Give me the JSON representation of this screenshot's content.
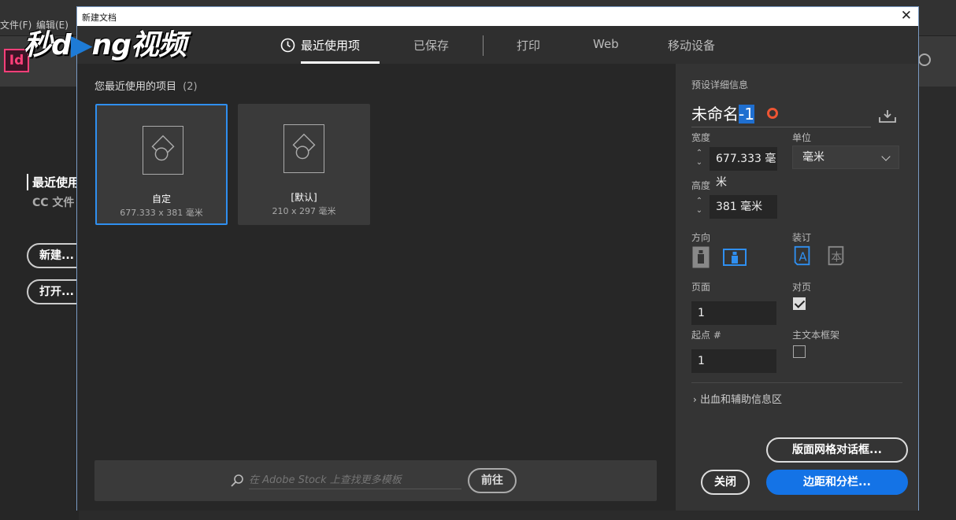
{
  "app": {
    "menu": [
      "文件(F)",
      "编辑(E)"
    ],
    "logo": "Id",
    "watermark": "秒懂视频",
    "left_panel": {
      "recent": "最近使用",
      "cc_files": "CC 文件",
      "new_button": "新建...",
      "open_button": "打开..."
    }
  },
  "dialog": {
    "title": "新建文档",
    "close_glyph": "✕",
    "tabs": [
      {
        "label": "最近使用项",
        "active": true
      },
      {
        "label": "已保存",
        "active": false
      },
      {
        "label": "打印",
        "active": false
      },
      {
        "label": "Web",
        "active": false
      },
      {
        "label": "移动设备",
        "active": false
      }
    ],
    "recent_label": "您最近使用的项目",
    "recent_count": "(2)",
    "presets": [
      {
        "name": "自定",
        "size": "677.333 x 381 毫米",
        "selected": true
      },
      {
        "name": "[默认]",
        "size": "210 x 297 毫米",
        "selected": false
      }
    ],
    "search": {
      "placeholder": "在 Adobe Stock 上查找更多模板",
      "go_label": "前往"
    }
  },
  "panel": {
    "heading": "预设详细信息",
    "doc_name": "未命名",
    "doc_name_selected": "-1",
    "width_label": "宽度",
    "width_value": "677.333 毫米",
    "unit_label": "单位",
    "unit_value": "毫米",
    "height_label": "高度",
    "height_value": "381 毫米",
    "orientation_label": "方向",
    "orientation": "landscape",
    "binding_label": "装订",
    "binding": "left-to-right",
    "pages_label": "页面",
    "pages_value": "1",
    "facing_label": "对页",
    "facing_checked": true,
    "start_label": "起点 #",
    "start_value": "1",
    "primary_frame_label": "主文本框架",
    "primary_frame_checked": false,
    "bleed_label": "出血和辅助信息区",
    "layout_grid_button": "版面网格对话框...",
    "close_button": "关闭",
    "margins_button": "边距和分栏..."
  },
  "colors": {
    "accent": "#1473e6",
    "selection": "#2f8ff0",
    "indesign": "#ff3f79"
  }
}
